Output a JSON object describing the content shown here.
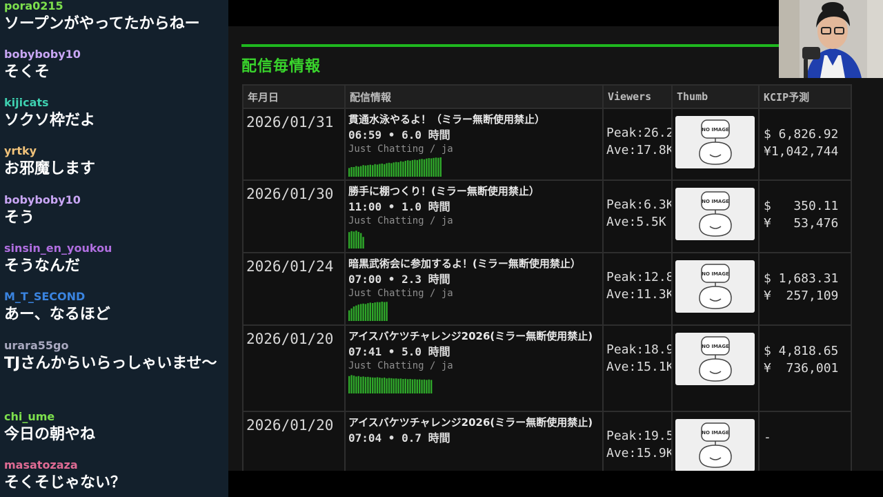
{
  "chat": {
    "messages": [
      {
        "user": "pora0215",
        "color": "#7de04d",
        "text": "ソープンがやってたからねー"
      },
      {
        "user": "bobyboby10",
        "color": "#c9a6f5",
        "text": "そくそ"
      },
      {
        "user": "kijicats",
        "color": "#3ed0b0",
        "text": "ソクソ枠だよ"
      },
      {
        "user": "yrtky",
        "color": "#f0c27a",
        "text": "お邪魔します"
      },
      {
        "user": "bobyboby10",
        "color": "#c9a6f5",
        "text": "そう"
      },
      {
        "user": "sinsin_en_youkou",
        "color": "#b06ee0",
        "text": "そうなんだ"
      },
      {
        "user": "M_T_SECOND",
        "color": "#3a84e0",
        "text": "あー、なるほど"
      },
      {
        "user": "urara55go",
        "color": "#a9a9c0",
        "text": "TJさんからいらっしゃいませ〜"
      },
      {
        "user": "chi_ume",
        "color": "#7de04d",
        "text": "今日の朝やね"
      },
      {
        "user": "masatozaza",
        "color": "#e06b94",
        "text": "そくそじゃない？"
      }
    ]
  },
  "page": {
    "section_title": "配信毎情報",
    "accent_color": "#39d42c",
    "columns": [
      "年月日",
      "配信情報",
      "Viewers",
      "Thumb",
      "KCIP予測"
    ],
    "thumb_text": "NO IMAGE",
    "rows": [
      {
        "date": "2026/01/31",
        "title": "貫通水泳やるよ！（ミラー無断使用禁止）",
        "time": "06:59 • 6.0 時間",
        "category": "Just Chatting / ja",
        "peak": "Peak:26.2",
        "ave": "Ave:17.8K",
        "usd": "$ 6,826.92",
        "jpy": "¥1,042,744",
        "spark": [
          0.45,
          0.5,
          0.5,
          0.55,
          0.52,
          0.55,
          0.6,
          0.58,
          0.6,
          0.62,
          0.6,
          0.65,
          0.63,
          0.66,
          0.68,
          0.65,
          0.7,
          0.72,
          0.7,
          0.74,
          0.76,
          0.75,
          0.8,
          0.78,
          0.82,
          0.85,
          0.83,
          0.86,
          0.88,
          0.86,
          0.9,
          0.92,
          0.9,
          0.94,
          0.96,
          0.95,
          0.97,
          0.99,
          0.98,
          1.0
        ]
      },
      {
        "date": "2026/01/30",
        "title": "勝手に棚つくり！(ミラー無断使用禁止）",
        "time": "11:00 • 1.0 時間",
        "category": "Just Chatting / ja",
        "peak": "Peak:6.3K",
        "ave": "Ave:5.5K",
        "usd": "$   350.11",
        "jpy": "¥   53,476",
        "spark": [
          0.85,
          0.9,
          0.88,
          0.92,
          0.86,
          0.8,
          0.6
        ]
      },
      {
        "date": "2026/01/24",
        "title": "暗黒武術会に参加するよ！(ミラー無断使用禁止）",
        "time": "07:00 • 2.3 時間",
        "category": "Just Chatting / ja",
        "peak": "Peak:12.8",
        "ave": "Ave:11.3K",
        "usd": "$ 1,683.31",
        "jpy": "¥  257,109",
        "spark": [
          0.55,
          0.65,
          0.75,
          0.8,
          0.85,
          0.88,
          0.9,
          0.88,
          0.92,
          0.95,
          0.93,
          0.96,
          0.98,
          0.97,
          1.0,
          0.98,
          0.99
        ]
      },
      {
        "date": "2026/01/20",
        "title": "アイスバケツチャレンジ2026(ミラー無断使用禁止)",
        "time": "07:41 • 5.0 時間",
        "category": "Just Chatting / ja",
        "peak": "Peak:18.9",
        "ave": "Ave:15.1K",
        "usd": "$ 4,818.65",
        "jpy": "¥  736,001",
        "spark": [
          0.9,
          0.95,
          0.92,
          0.88,
          0.9,
          0.86,
          0.88,
          0.85,
          0.86,
          0.84,
          0.83,
          0.82,
          0.84,
          0.82,
          0.8,
          0.82,
          0.78,
          0.8,
          0.79,
          0.77,
          0.78,
          0.76,
          0.77,
          0.75,
          0.76,
          0.74,
          0.75,
          0.73,
          0.74,
          0.72,
          0.73,
          0.71,
          0.72,
          0.7,
          0.72,
          0.7
        ]
      },
      {
        "date": "2026/01/20",
        "title": "アイスバケツチャレンジ2026(ミラー無断使用禁止)",
        "time": "07:04 • 0.7 時間",
        "category": "",
        "peak": "Peak:19.5",
        "ave": "Ave:15.9K",
        "usd": "-",
        "jpy": "",
        "spark": []
      }
    ]
  }
}
